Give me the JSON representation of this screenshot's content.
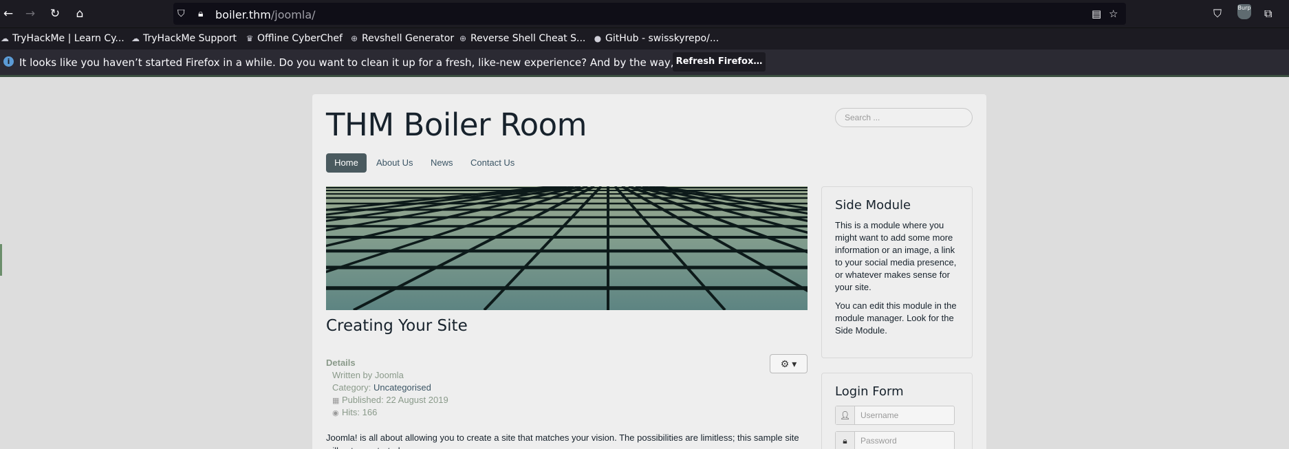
{
  "browser": {
    "url_host": "boiler.thm",
    "url_path": "/joomla/",
    "bookmarks": [
      "TryHackMe | Learn Cy...",
      "TryHackMe Support",
      "Offline CyberChef",
      "Revshell Generator",
      "Reverse Shell Cheat S...",
      "GitHub - swisskyrepo/..."
    ],
    "notification_text": "It looks like you haven’t started Firefox in a while. Do you want to clean it up for a fresh, like-new experience? And by the way, welcome back!",
    "notification_button": "Refresh Firefox…",
    "burp_label": "Burp"
  },
  "site": {
    "title": "THM Boiler Room",
    "search_placeholder": "Search ...",
    "nav": [
      "Home",
      "About Us",
      "News",
      "Contact Us"
    ],
    "active_nav": "Home"
  },
  "article": {
    "title": "Creating Your Site",
    "details_label": "Details",
    "written_by": "Written by Joomla",
    "category_label": "Category:",
    "category_value": "Uncategorised",
    "published": "Published: 22 August 2019",
    "hits": "Hits: 166",
    "body": "Joomla! is all about allowing you to create a site that matches your vision. The possibilities are limitless; this sample site will get you started."
  },
  "side_module": {
    "title": "Side Module",
    "p1": "This is a module where you might want to add some more information or an image, a link to your social media presence, or whatever makes sense for your site.",
    "p2": "You can edit this module in the module manager. Look for the Side Module."
  },
  "login_form": {
    "title": "Login Form",
    "username_placeholder": "Username",
    "password_placeholder": "Password"
  }
}
